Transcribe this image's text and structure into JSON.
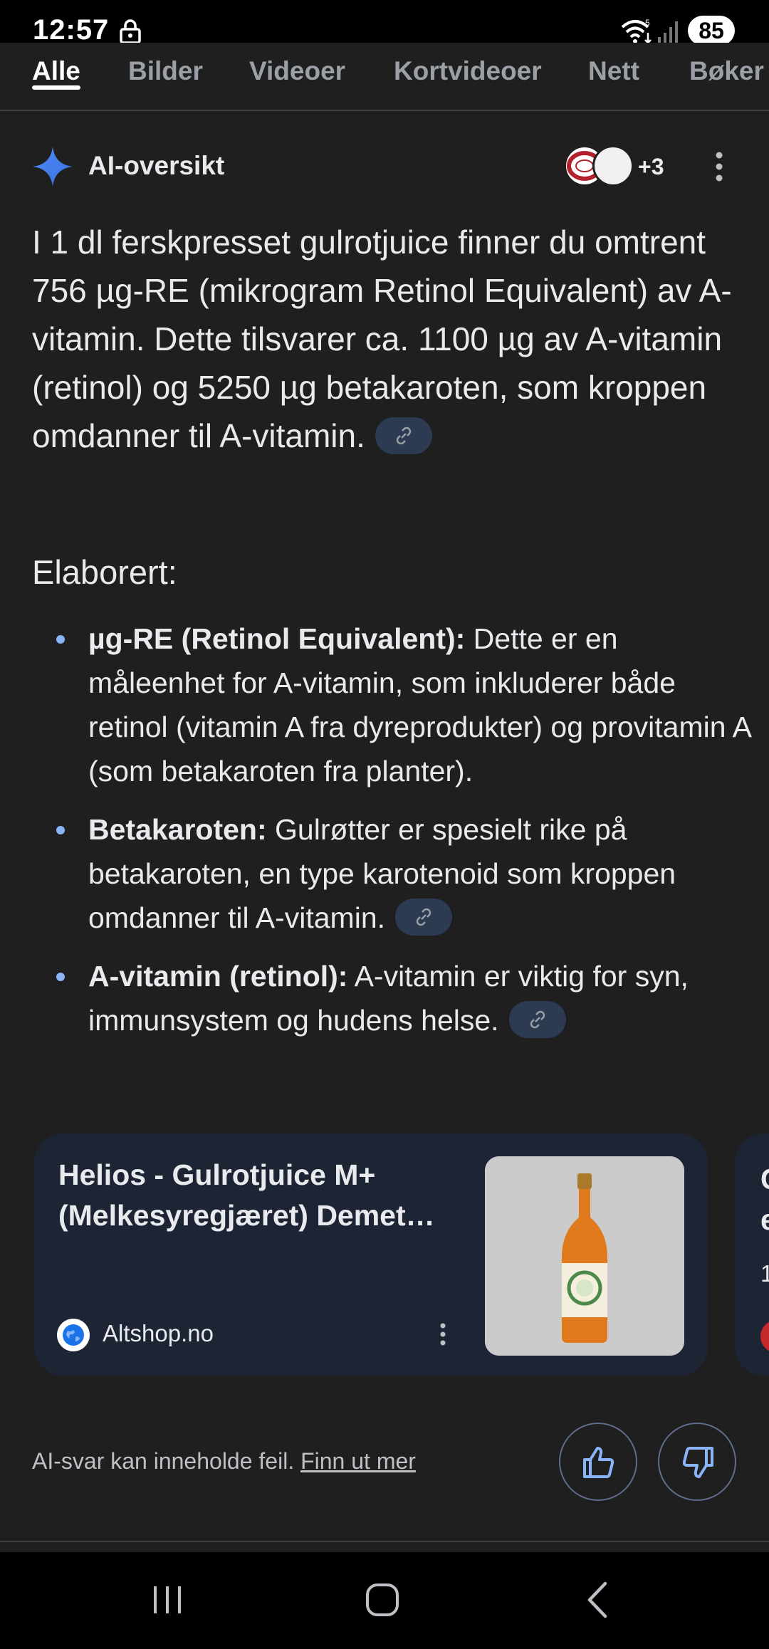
{
  "status_bar": {
    "time": "12:57",
    "battery": "85",
    "wifi_badge": "5"
  },
  "tabs": [
    {
      "label": "Alle",
      "active": true
    },
    {
      "label": "Bilder",
      "active": false
    },
    {
      "label": "Videoer",
      "active": false
    },
    {
      "label": "Kortvideoer",
      "active": false
    },
    {
      "label": "Nett",
      "active": false
    },
    {
      "label": "Bøker",
      "active": false
    }
  ],
  "ai": {
    "title": "AI-oversikt",
    "more_sources": "+3",
    "lead": "I 1 dl ferskpresset gulrotjuice finner du omtrent 756 µg-RE (mikrogram Retinol Equivalent) av A-vitamin. Dette tilsvarer ca. 1100 µg av A-vitamin (retinol) og 5250 µg betakaroten, som kroppen omdanner til A-vitamin.",
    "subheading": "Elaborert:",
    "bullets": [
      {
        "term": "µg-RE (Retinol Equivalent):",
        "text": " Dette er en måleenhet for A-vitamin, som inkluderer både retinol (vitamin A fra dyreprodukter) og provitamin A (som betakaroten fra planter)."
      },
      {
        "term": "Betakaroten:",
        "text": " Gulrøtter er spesielt rike på betakaroten, en type karotenoid som kroppen omdanner til A-vitamin."
      },
      {
        "term": "A-vitamin (retinol):",
        "text": " A-vitamin er viktig for syn, immunsystem og hudens helse."
      }
    ]
  },
  "card": {
    "title": "Helios - Gulrotjuice M+ (Melkesyregjæret) Demet…",
    "source": "Altshop.no",
    "peek_title": "C\ne",
    "peek_sub": "1"
  },
  "footer": {
    "disclaimer": "AI-svar kan inneholde feil. ",
    "learn_more": "Finn ut mer"
  },
  "colors": {
    "background": "#1f1f1f",
    "card": "#1d2434",
    "accent": "#8ab4f8",
    "chip": "#2c3a52"
  }
}
